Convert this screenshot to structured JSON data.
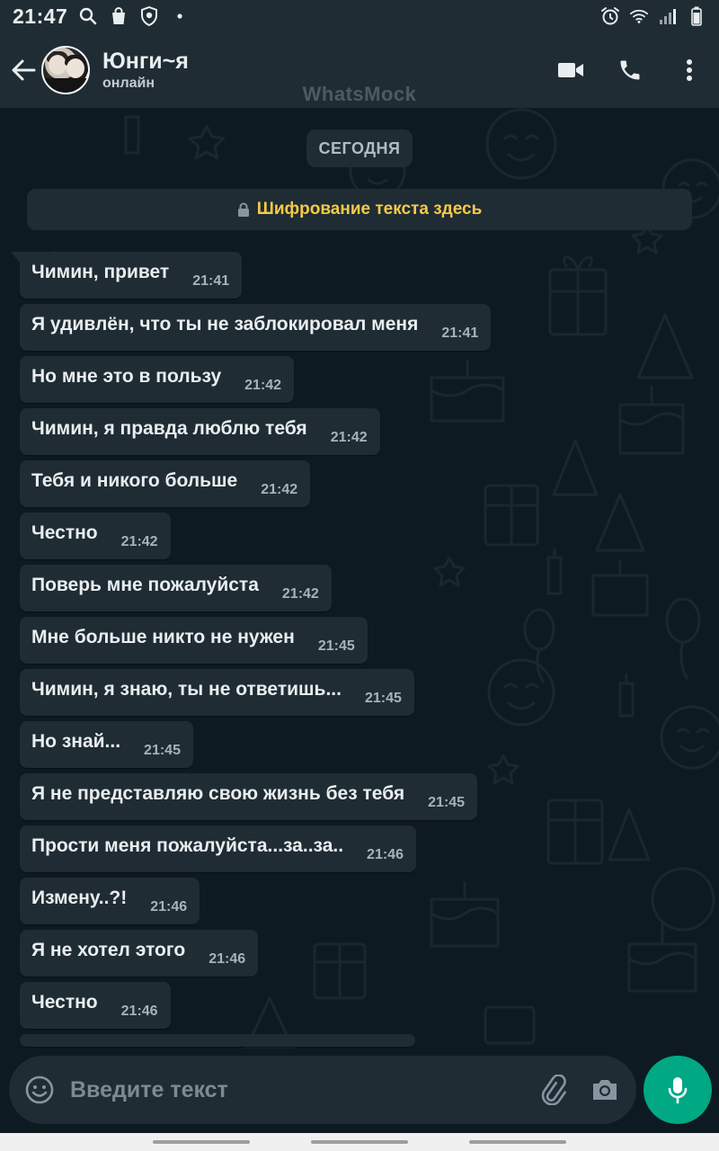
{
  "status_bar": {
    "time": "21:47",
    "left_icons": [
      "search-icon",
      "shopping-bag-icon",
      "shield-icon",
      "dot-icon"
    ],
    "right_icons": [
      "alarm-icon",
      "wifi-icon",
      "signal-icon",
      "battery-icon"
    ]
  },
  "header": {
    "contact_name": "Юнги~я",
    "contact_status": "онлайн",
    "actions": [
      "video-call-icon",
      "phone-icon",
      "more-vertical-icon"
    ],
    "watermark": "WhatsMock"
  },
  "chat": {
    "date_chip": "СЕГОДНЯ",
    "encryption_banner": "Шифрование текста здесь",
    "messages": [
      {
        "text": "Чимин, привет",
        "time": "21:41"
      },
      {
        "text": "Я удивлён, что ты не заблокировал меня",
        "time": "21:41"
      },
      {
        "text": "Но мне это в пользу",
        "time": "21:42"
      },
      {
        "text": "Чимин, я правда люблю тебя",
        "time": "21:42"
      },
      {
        "text": "Тебя и никого больше",
        "time": "21:42"
      },
      {
        "text": "Честно",
        "time": "21:42"
      },
      {
        "text": "Поверь мне пожалуйста",
        "time": "21:42"
      },
      {
        "text": "Мне больше никто не нужен",
        "time": "21:45"
      },
      {
        "text": "Чимин, я знаю, ты не ответишь...",
        "time": "21:45"
      },
      {
        "text": "Но знай...",
        "time": "21:45"
      },
      {
        "text": "Я не представляю свою жизнь без тебя",
        "time": "21:45"
      },
      {
        "text": "Прости меня пожалуйста...за..за..",
        "time": "21:46"
      },
      {
        "text": "Измену..?!",
        "time": "21:46"
      },
      {
        "text": "Я не хотел этого",
        "time": "21:46"
      },
      {
        "text": "Честно",
        "time": "21:46"
      }
    ]
  },
  "input_bar": {
    "placeholder": "Введите текст",
    "icons": [
      "emoji-icon",
      "attach-icon",
      "camera-icon",
      "mic-icon"
    ]
  },
  "colors": {
    "header_bg": "#1f2c34",
    "chat_bg": "#0e1a21",
    "bubble_bg": "#1f2c34",
    "encryption_text": "#f7c948",
    "accent": "#00a884"
  }
}
